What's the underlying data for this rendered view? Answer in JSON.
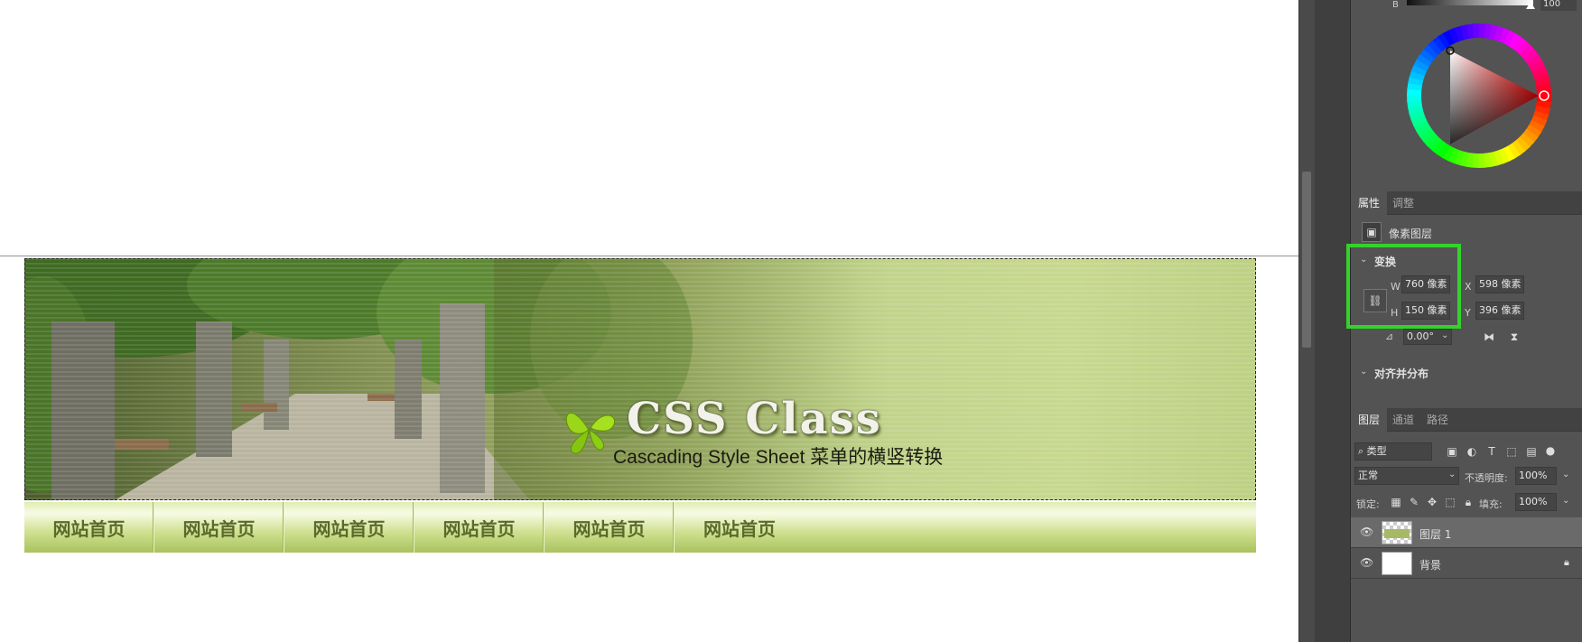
{
  "banner": {
    "title": "CSS Class",
    "subtitle": "Cascading Style Sheet 菜单的横竖转换"
  },
  "nav": {
    "items": [
      "网站首页",
      "网站首页",
      "网站首页",
      "网站首页",
      "网站首页",
      "网站首页"
    ]
  },
  "color_panel": {
    "channel_label": "B",
    "channel_value": "100"
  },
  "properties": {
    "tabs": [
      "属性",
      "调整"
    ],
    "active_tab": "属性",
    "layer_type": "像素图层",
    "transform_header": "变换",
    "w_label": "W",
    "w_value": "760 像素",
    "h_label": "H",
    "h_value": "150 像素",
    "x_label": "X",
    "x_value": "598 像素",
    "y_label": "Y",
    "y_value": "396 像素",
    "angle_value": "0.00°",
    "align_header": "对齐并分布"
  },
  "layers": {
    "tabs": [
      "图层",
      "通道",
      "路径"
    ],
    "active_tab": "图层",
    "filter_label": "类型",
    "blend_mode": "正常",
    "opacity_label": "不透明度:",
    "opacity_value": "100%",
    "lock_label": "锁定:",
    "fill_label": "填充:",
    "fill_value": "100%",
    "items": [
      {
        "name": "图层 1",
        "selected": true
      },
      {
        "name": "背景",
        "selected": false
      }
    ]
  },
  "colors": {
    "highlight": "#35d22b",
    "panel_bg": "#535353",
    "nav_text": "#5a6a2a"
  }
}
